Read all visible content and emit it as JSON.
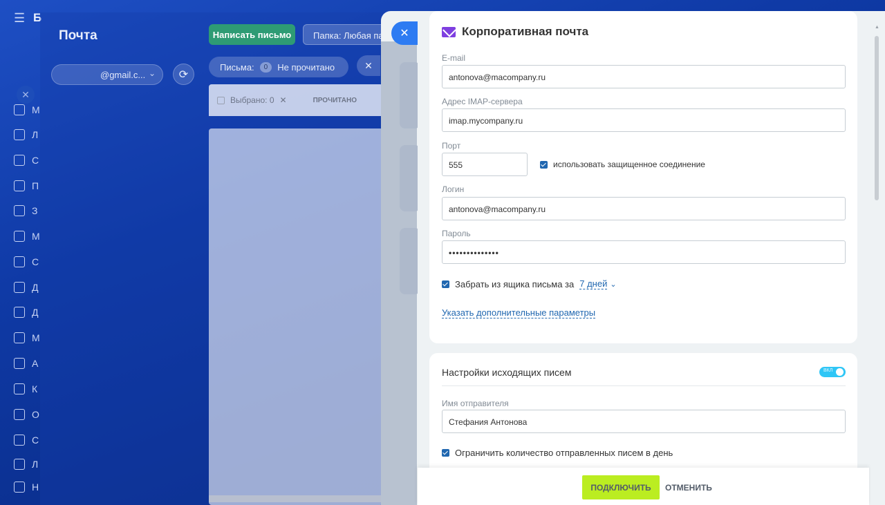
{
  "background": {
    "brand_letter": "Б",
    "mail_title": "Почта",
    "account_label": "@gmail.c...",
    "write_button": "Написать письмо",
    "folder_label": "Папка: Любая пап",
    "letters_label": "Письма:",
    "unread_count": "0",
    "unread_label": "Не прочитано",
    "selected_label": "Выбрано: 0",
    "read_button": "ПРОЧИТАНО",
    "rail_letters": [
      "М",
      "Л",
      "С",
      "П",
      "З",
      "М",
      "С",
      "Д",
      "Д",
      "М",
      "А",
      "К",
      "О",
      "С",
      "Л",
      "Н"
    ]
  },
  "form": {
    "title": "Корпоративная почта",
    "email_label": "E-mail",
    "email_value": "antonova@macompany.ru",
    "imap_label": "Адрес IMAP-сервера",
    "imap_value": "imap.mycompany.ru",
    "port_label": "Порт",
    "port_value": "555",
    "secure_label": "использовать защищенное соединение",
    "login_label": "Логин",
    "login_value": "antonova@macompany.ru",
    "password_label": "Пароль",
    "password_value": "••••••••••••••",
    "fetch_label": "Забрать из ящика письма за",
    "fetch_days": "7 дней",
    "advanced_link": "Указать дополнительные параметры"
  },
  "outgoing": {
    "title": "Настройки исходящих писем",
    "toggle_label": "ВКЛ",
    "sender_label": "Имя отправителя",
    "sender_value": "Стефания Антонова",
    "limit_label": "Ограничить количество отправленных писем в день"
  },
  "footer": {
    "connect_button": "ПОДКЛЮЧИТЬ",
    "cancel_button": "ОТМЕНИТЬ"
  },
  "colors": {
    "accent": "#2067b0",
    "connect": "#bbed21",
    "toggle": "#2fc6f6",
    "close": "#2d7bf2",
    "mail_icon": "#7e3fe0"
  }
}
